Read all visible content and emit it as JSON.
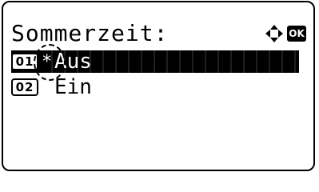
{
  "screen": {
    "title": "Sommerzeit:",
    "nav_icon": "four-way-arrow-icon",
    "ok_icon_label": "OK"
  },
  "options": [
    {
      "number": "01",
      "marker": "*",
      "label": "Aus",
      "selected": true
    },
    {
      "number": "02",
      "marker": "",
      "label": "Ein",
      "selected": false
    }
  ],
  "colors": {
    "foreground": "#000000",
    "background": "#ffffff",
    "highlight": "#000000",
    "highlight_text": "#ffffff"
  }
}
